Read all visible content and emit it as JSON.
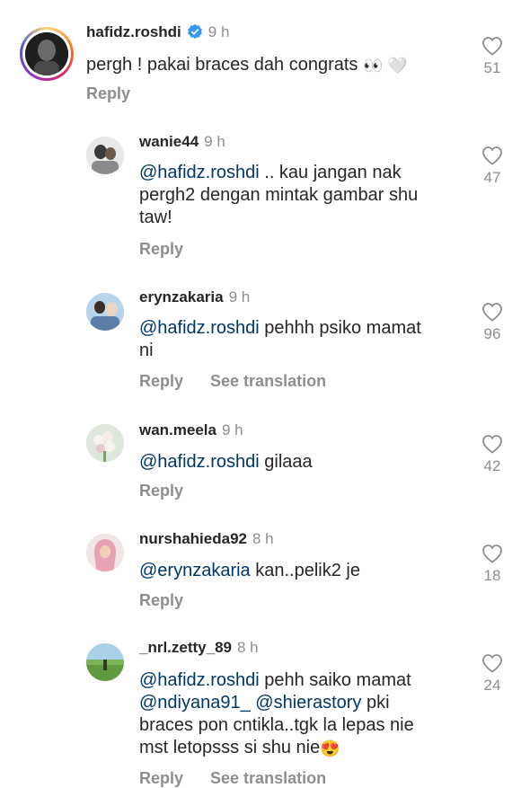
{
  "ui": {
    "reply_label": "Reply",
    "see_translation_label": "See translation"
  },
  "comments": [
    {
      "username": "hafidz.roshdi",
      "verified": true,
      "time": "9 h",
      "text_plain": "pergh ! pakai braces dah congrats",
      "emojis": "👀 🤍",
      "likes": "51",
      "show_translation": false
    },
    {
      "username": "wanie44",
      "time": "9 h",
      "mention": "@hafidz.roshdi",
      "line1_rest": " .. kau jangan nak",
      "line2": "pergh2 dengan mintak gambar shu",
      "line3": "taw!",
      "likes": "47",
      "show_translation": false
    },
    {
      "username": "erynzakaria",
      "time": "9 h",
      "mention": "@hafidz.roshdi",
      "line1_rest": " pehhh psiko mamat",
      "line2": "ni",
      "likes": "96",
      "show_translation": true
    },
    {
      "username": "wan.meela",
      "time": "9 h",
      "mention": "@hafidz.roshdi",
      "line1_rest": " gilaaa",
      "likes": "42",
      "show_translation": false
    },
    {
      "username": "nurshahieda92",
      "time": "8 h",
      "mention": "@erynzakaria",
      "line1_rest": " kan..pelik2 je",
      "likes": "18",
      "show_translation": false
    },
    {
      "username": "_nrl.zetty_89",
      "time": "8 h",
      "mention": "@hafidz.roshdi",
      "line1_rest": " pehh saiko mamat",
      "line2_mention1": "@ndiyana91_",
      "line2_mention2": "@shierastory",
      "line2_rest": " pki",
      "line3": "braces pon cntikla..tgk la lepas nie",
      "line4": "mst letopsss si shu nie",
      "emoji": "😍",
      "likes": "24",
      "show_translation": true
    }
  ]
}
